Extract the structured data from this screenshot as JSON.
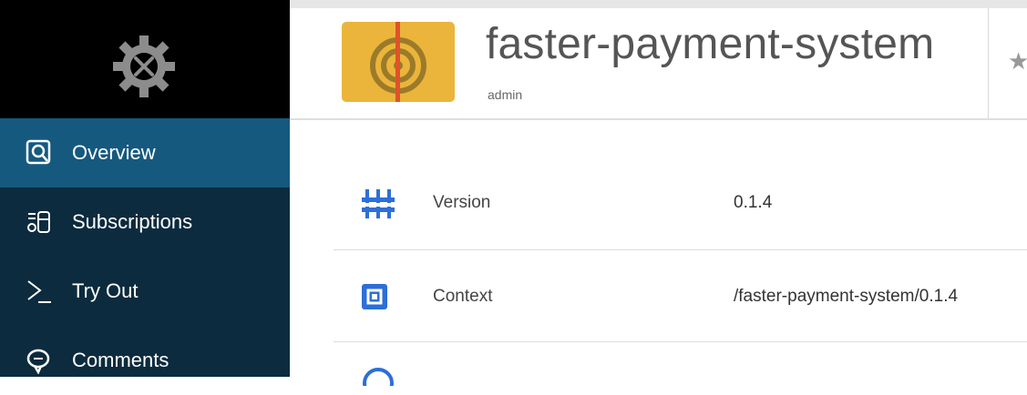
{
  "sidebar": {
    "logo_icon": "gear-tools-icon",
    "items": [
      {
        "label": "Overview",
        "icon": "overview-icon",
        "active": true
      },
      {
        "label": "Subscriptions",
        "icon": "subscriptions-icon",
        "active": false
      },
      {
        "label": "Try Out",
        "icon": "terminal-icon",
        "active": false
      },
      {
        "label": "Comments",
        "icon": "comment-icon",
        "active": false
      }
    ]
  },
  "header": {
    "title": "faster-payment-system",
    "owner": "admin",
    "star_icon": "star-icon"
  },
  "details": [
    {
      "label": "Version",
      "value": "0.1.4",
      "icon": "version-icon"
    },
    {
      "label": "Context",
      "value": "/faster-payment-system/0.1.4",
      "icon": "context-icon"
    }
  ],
  "colors": {
    "sidebar_bg": "#0c2b3e",
    "sidebar_active": "#15597f",
    "logo_bg": "#000000",
    "accent_blue": "#2d6fd8",
    "thumb_bg": "#eab53a",
    "thumb_line": "#e0522a"
  }
}
